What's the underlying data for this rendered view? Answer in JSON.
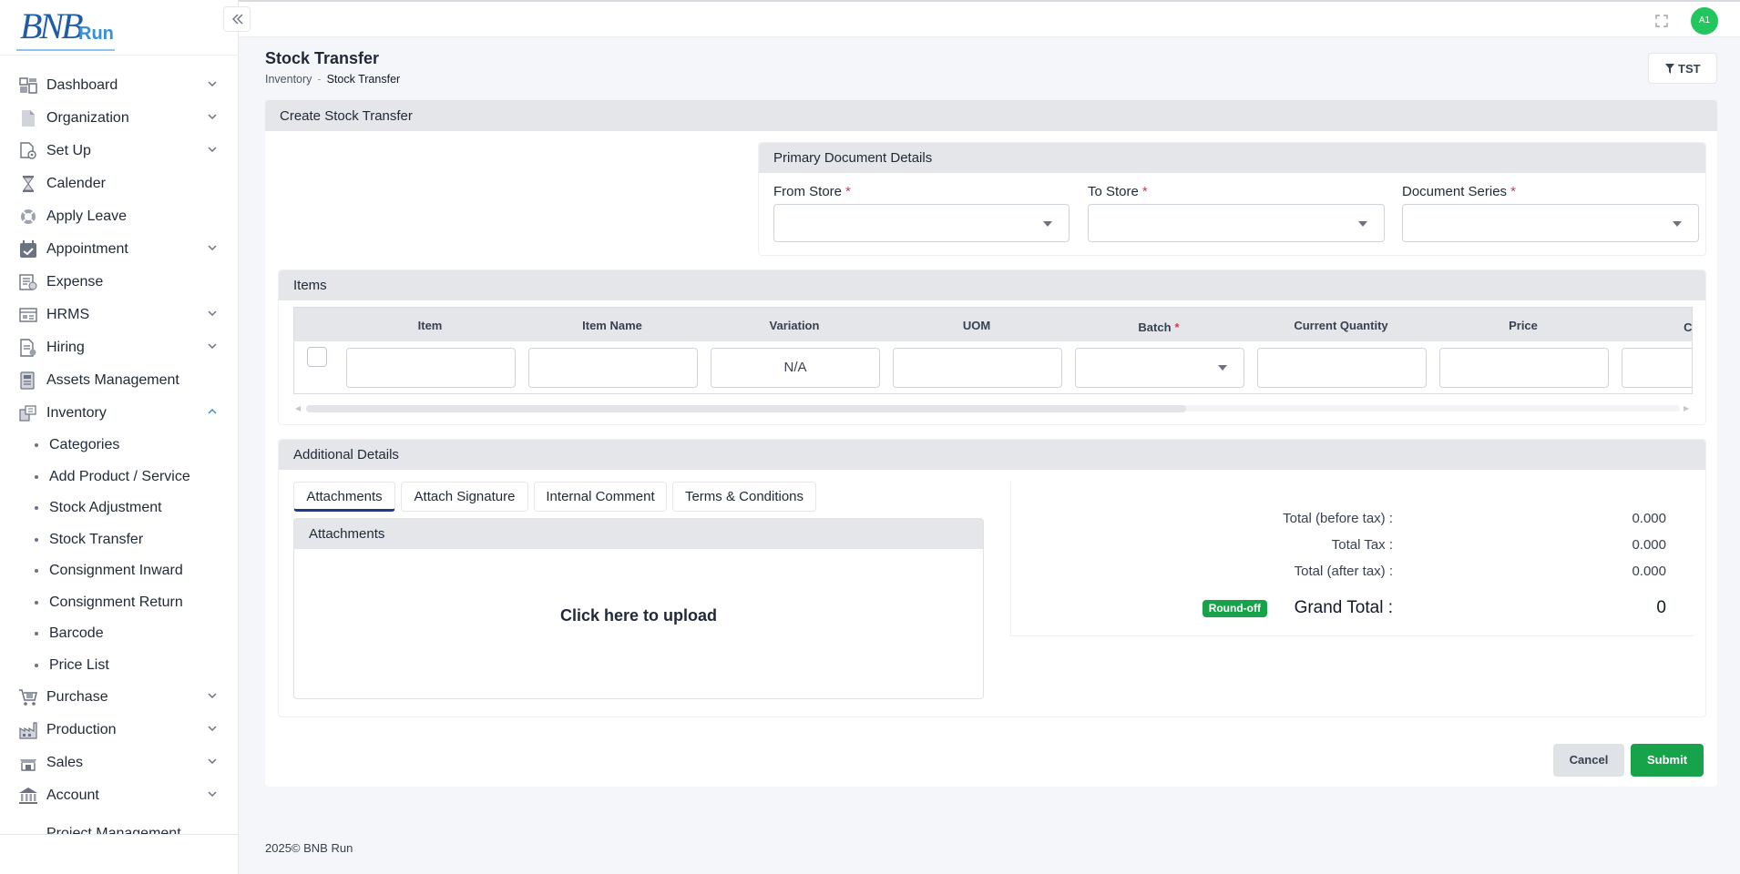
{
  "brand": {
    "logo_main": "BNB",
    "logo_sub": "Run"
  },
  "sidebar": {
    "items": [
      {
        "label": "Dashboard",
        "icon": "dashboard-icon",
        "expandable": true
      },
      {
        "label": "Organization",
        "icon": "document-icon",
        "expandable": true
      },
      {
        "label": "Set Up",
        "icon": "setup-icon",
        "expandable": true
      },
      {
        "label": "Calender",
        "icon": "hourglass-icon",
        "expandable": false
      },
      {
        "label": "Apply Leave",
        "icon": "lifebuoy-icon",
        "expandable": false
      },
      {
        "label": "Appointment",
        "icon": "calendar-check-icon",
        "expandable": true
      },
      {
        "label": "Expense",
        "icon": "expense-icon",
        "expandable": false
      },
      {
        "label": "HRMS",
        "icon": "hrms-icon",
        "expandable": true
      },
      {
        "label": "Hiring",
        "icon": "hiring-icon",
        "expandable": true
      },
      {
        "label": "Assets Management",
        "icon": "assets-icon",
        "expandable": false
      },
      {
        "label": "Inventory",
        "icon": "inventory-icon",
        "expandable": true,
        "expanded": true
      }
    ],
    "inventory_sub": [
      "Categories",
      "Add Product / Service",
      "Stock Adjustment",
      "Stock Transfer",
      "Consignment Inward",
      "Consignment Return",
      "Barcode",
      "Price List"
    ],
    "items_after": [
      {
        "label": "Purchase",
        "icon": "cart-icon",
        "expandable": true
      },
      {
        "label": "Production",
        "icon": "factory-icon",
        "expandable": true
      },
      {
        "label": "Sales",
        "icon": "sales-icon",
        "expandable": true
      },
      {
        "label": "Account",
        "icon": "bank-icon",
        "expandable": true
      }
    ],
    "cut_item": "Project Management"
  },
  "header": {
    "avatar_initials": "A1"
  },
  "page": {
    "title": "Stock Transfer",
    "breadcrumb": [
      "Inventory",
      "Stock Transfer"
    ],
    "breadcrumb_sep": "-",
    "filter_label": "TST"
  },
  "form": {
    "card_title": "Create Stock Transfer",
    "primary_title": "Primary Document Details",
    "from_store": "From Store",
    "to_store": "To Store",
    "document_series": "Document Series",
    "required_mark": "*"
  },
  "items": {
    "title": "Items",
    "columns": [
      "Item",
      "Item Name",
      "Variation",
      "UOM",
      "Batch",
      "Current Quantity",
      "Price",
      "Change"
    ],
    "variation_value": "N/A"
  },
  "additional": {
    "title": "Additional Details",
    "tabs": [
      "Attachments",
      "Attach Signature",
      "Internal Comment",
      "Terms & Conditions"
    ],
    "active_tab": "Attachments",
    "attach_title": "Attachments",
    "upload_text": "Click here to upload"
  },
  "totals": {
    "before_tax_label": "Total (before tax) :",
    "before_tax": "0.000",
    "tax_label": "Total Tax :",
    "tax": "0.000",
    "after_tax_label": "Total (after tax) :",
    "after_tax": "0.000",
    "roundoff_label": "Round-off",
    "grand_label": "Grand Total :",
    "grand": "0"
  },
  "actions": {
    "cancel": "Cancel",
    "submit": "Submit"
  },
  "footer": {
    "text": "2025© BNB Run"
  },
  "colors": {
    "primary_green": "#16a34a",
    "brand_blue": "#1e5ba8",
    "required_red": "#dc3545",
    "avatar_green": "#22c55e"
  }
}
